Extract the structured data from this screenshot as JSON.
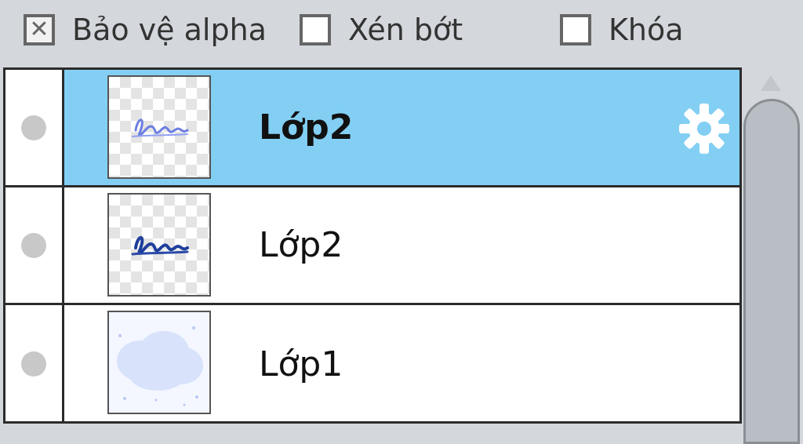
{
  "options": {
    "alpha_protect": {
      "label": "Bảo vệ alpha",
      "checked": true,
      "mark": "✕"
    },
    "clip": {
      "label": "Xén bớt",
      "checked": false
    },
    "lock": {
      "label": "Khóa",
      "checked": false
    }
  },
  "layers": [
    {
      "name": "Lớp2",
      "selected": true,
      "thumbnail": "handwriting-light"
    },
    {
      "name": "Lớp2",
      "selected": false,
      "thumbnail": "handwriting-dark"
    },
    {
      "name": "Lớp1",
      "selected": false,
      "thumbnail": "cloud"
    }
  ],
  "icons": {
    "settings": "gear-icon",
    "visibility": "visibility-dot-icon",
    "scroll_up": "scroll-up-arrow-icon"
  },
  "colors": {
    "selected_row": "#83cff4",
    "panel_bg": "#d4d8dc",
    "border": "#2b2b2b",
    "gear": "#ffffff"
  }
}
